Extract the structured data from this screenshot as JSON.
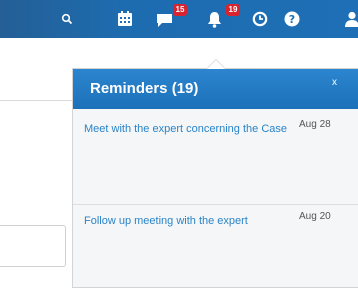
{
  "topbar": {
    "icons": [
      "search-icon",
      "calendar-icon",
      "chat-icon",
      "bell-icon",
      "clock-icon",
      "help-icon",
      "user-icon"
    ],
    "messages_badge": "15",
    "notifications_badge": "19"
  },
  "reminders": {
    "title": "Reminders (19)",
    "close_label": "x",
    "items": [
      {
        "text": "Meet with the expert concerning the Case",
        "date": "Aug 28"
      },
      {
        "text": "Follow up meeting with the expert",
        "date": "Aug 20"
      }
    ]
  },
  "colors": {
    "topbar": "#1f6fb6",
    "badge": "#d9232f",
    "link": "#2a84c8",
    "panel_header": "#1c71b9"
  }
}
